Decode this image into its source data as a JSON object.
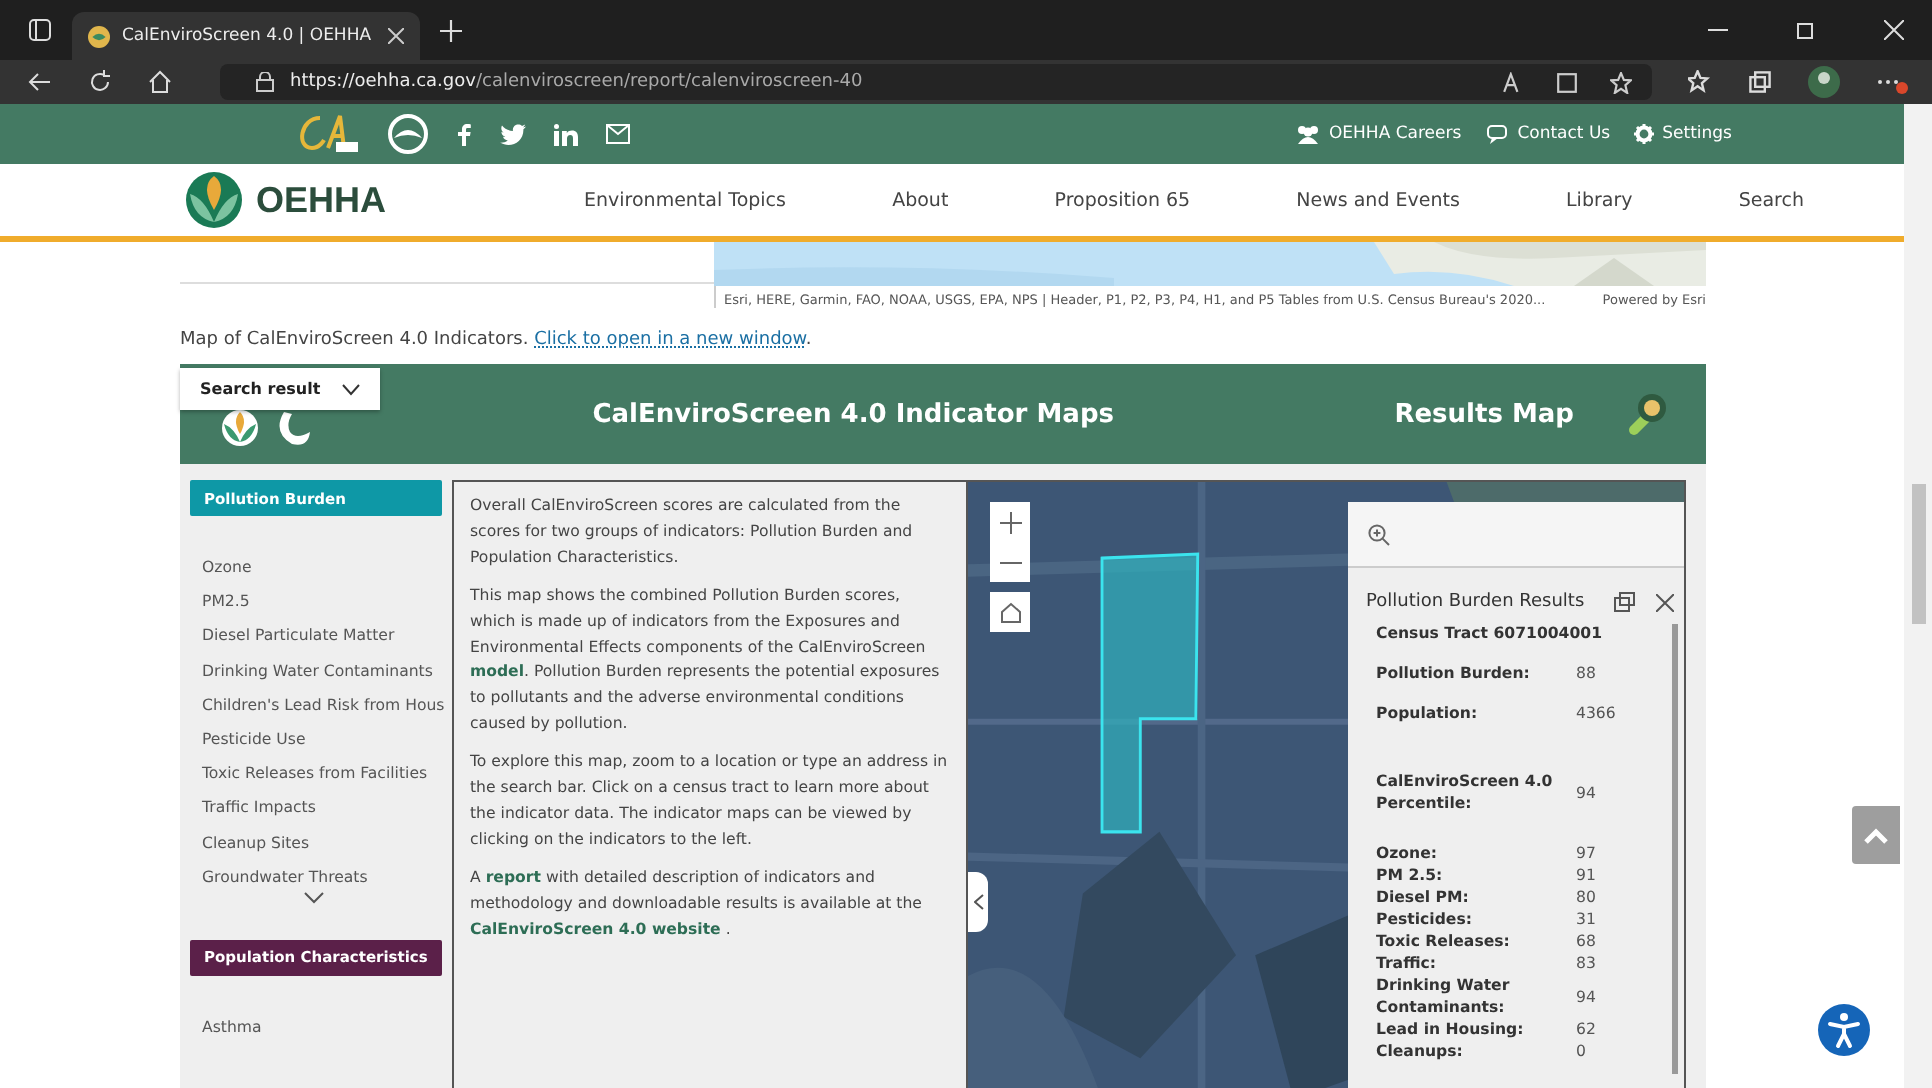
{
  "browser": {
    "tab_title": "CalEnviroScreen 4.0 | OEHHA",
    "url_host": "https://oehha.ca.gov",
    "url_path": "/calenviroscreen/report/calenviroscreen-40"
  },
  "top_bar": {
    "links": [
      "OEHHA Careers",
      "Contact Us",
      "Settings"
    ]
  },
  "header": {
    "logo": "OEHHA",
    "nav": [
      "Environmental Topics",
      "About",
      "Proposition 65",
      "News and Events",
      "Library",
      "Search"
    ]
  },
  "attribution": {
    "text": "Esri, HERE, Garmin, FAO, NOAA, USGS, EPA, NPS | Header, P1, P2, P3, P4, H1, and P5 Tables from U.S. Census Bureau's 2020...",
    "powered": "Powered by Esri"
  },
  "caption": {
    "text": "Map of CalEnviroScreen 4.0 Indicators.",
    "link": "Click to open in a new window",
    "end": "."
  },
  "app": {
    "title": "CalEnviroScreen 4.0 Indicator Maps",
    "results": "Results Map",
    "dropdown": "Search result"
  },
  "sidebar": [
    {
      "title": "Pollution Burden",
      "color": "#0e98a6",
      "items": [
        "Ozone",
        "PM2.5",
        "Diesel Particulate Matter",
        "Drinking Water Contaminants",
        "Children's Lead Risk from Hous",
        "Pesticide Use",
        "Toxic Releases from Facilities",
        "Traffic Impacts",
        "Cleanup Sites",
        "Groundwater Threats"
      ],
      "more": true
    },
    {
      "title": "Population Characteristics",
      "color": "#5b2049",
      "items": [
        "Asthma"
      ],
      "more": false
    }
  ],
  "description": [
    "Overall CalEnviroScreen scores are calculated from the scores for two groups of indicators: Pollution Burden and Population Characteristics.",
    "This map shows the combined Pollution Burden scores, which is made up of indicators from the Exposures and Environmental Effects components of the CalEnviroScreen **model**. Pollution Burden represents the potential exposures to pollutants and the adverse environmental conditions caused by pollution.",
    "To explore this map, zoom to a location or type an address in the search bar. Click on a census tract to learn more about the indicator data. The indicator maps can be viewed by clicking on the indicators to the left.",
    "A **report** with detailed description of indicators and methodology and downloadable results is available at the **CalEnviroScreen 4.0 website** ."
  ],
  "popup": {
    "title": "Pollution Burden Results",
    "tract": "Census Tract 6071004001",
    "sections": [
      [
        {
          "label": "Pollution Burden:",
          "value": "88"
        },
        {
          "label": "Population:",
          "value": "4366"
        }
      ],
      [
        {
          "label": "CalEnviroScreen 4.0 Percentile:",
          "value": "94"
        }
      ],
      [
        {
          "label": "Ozone:",
          "value": "97"
        },
        {
          "label": "PM 2.5:",
          "value": "91"
        },
        {
          "label": "Diesel PM:",
          "value": "80"
        },
        {
          "label": "Pesticides:",
          "value": "31"
        },
        {
          "label": "Toxic Releases:",
          "value": "68"
        },
        {
          "label": "Traffic:",
          "value": "83"
        },
        {
          "label": "Drinking Water Contaminants:",
          "value": "94"
        },
        {
          "label": "Lead in Housing:",
          "value": "62"
        },
        {
          "label": "Cleanups:",
          "value": "0"
        }
      ]
    ]
  }
}
